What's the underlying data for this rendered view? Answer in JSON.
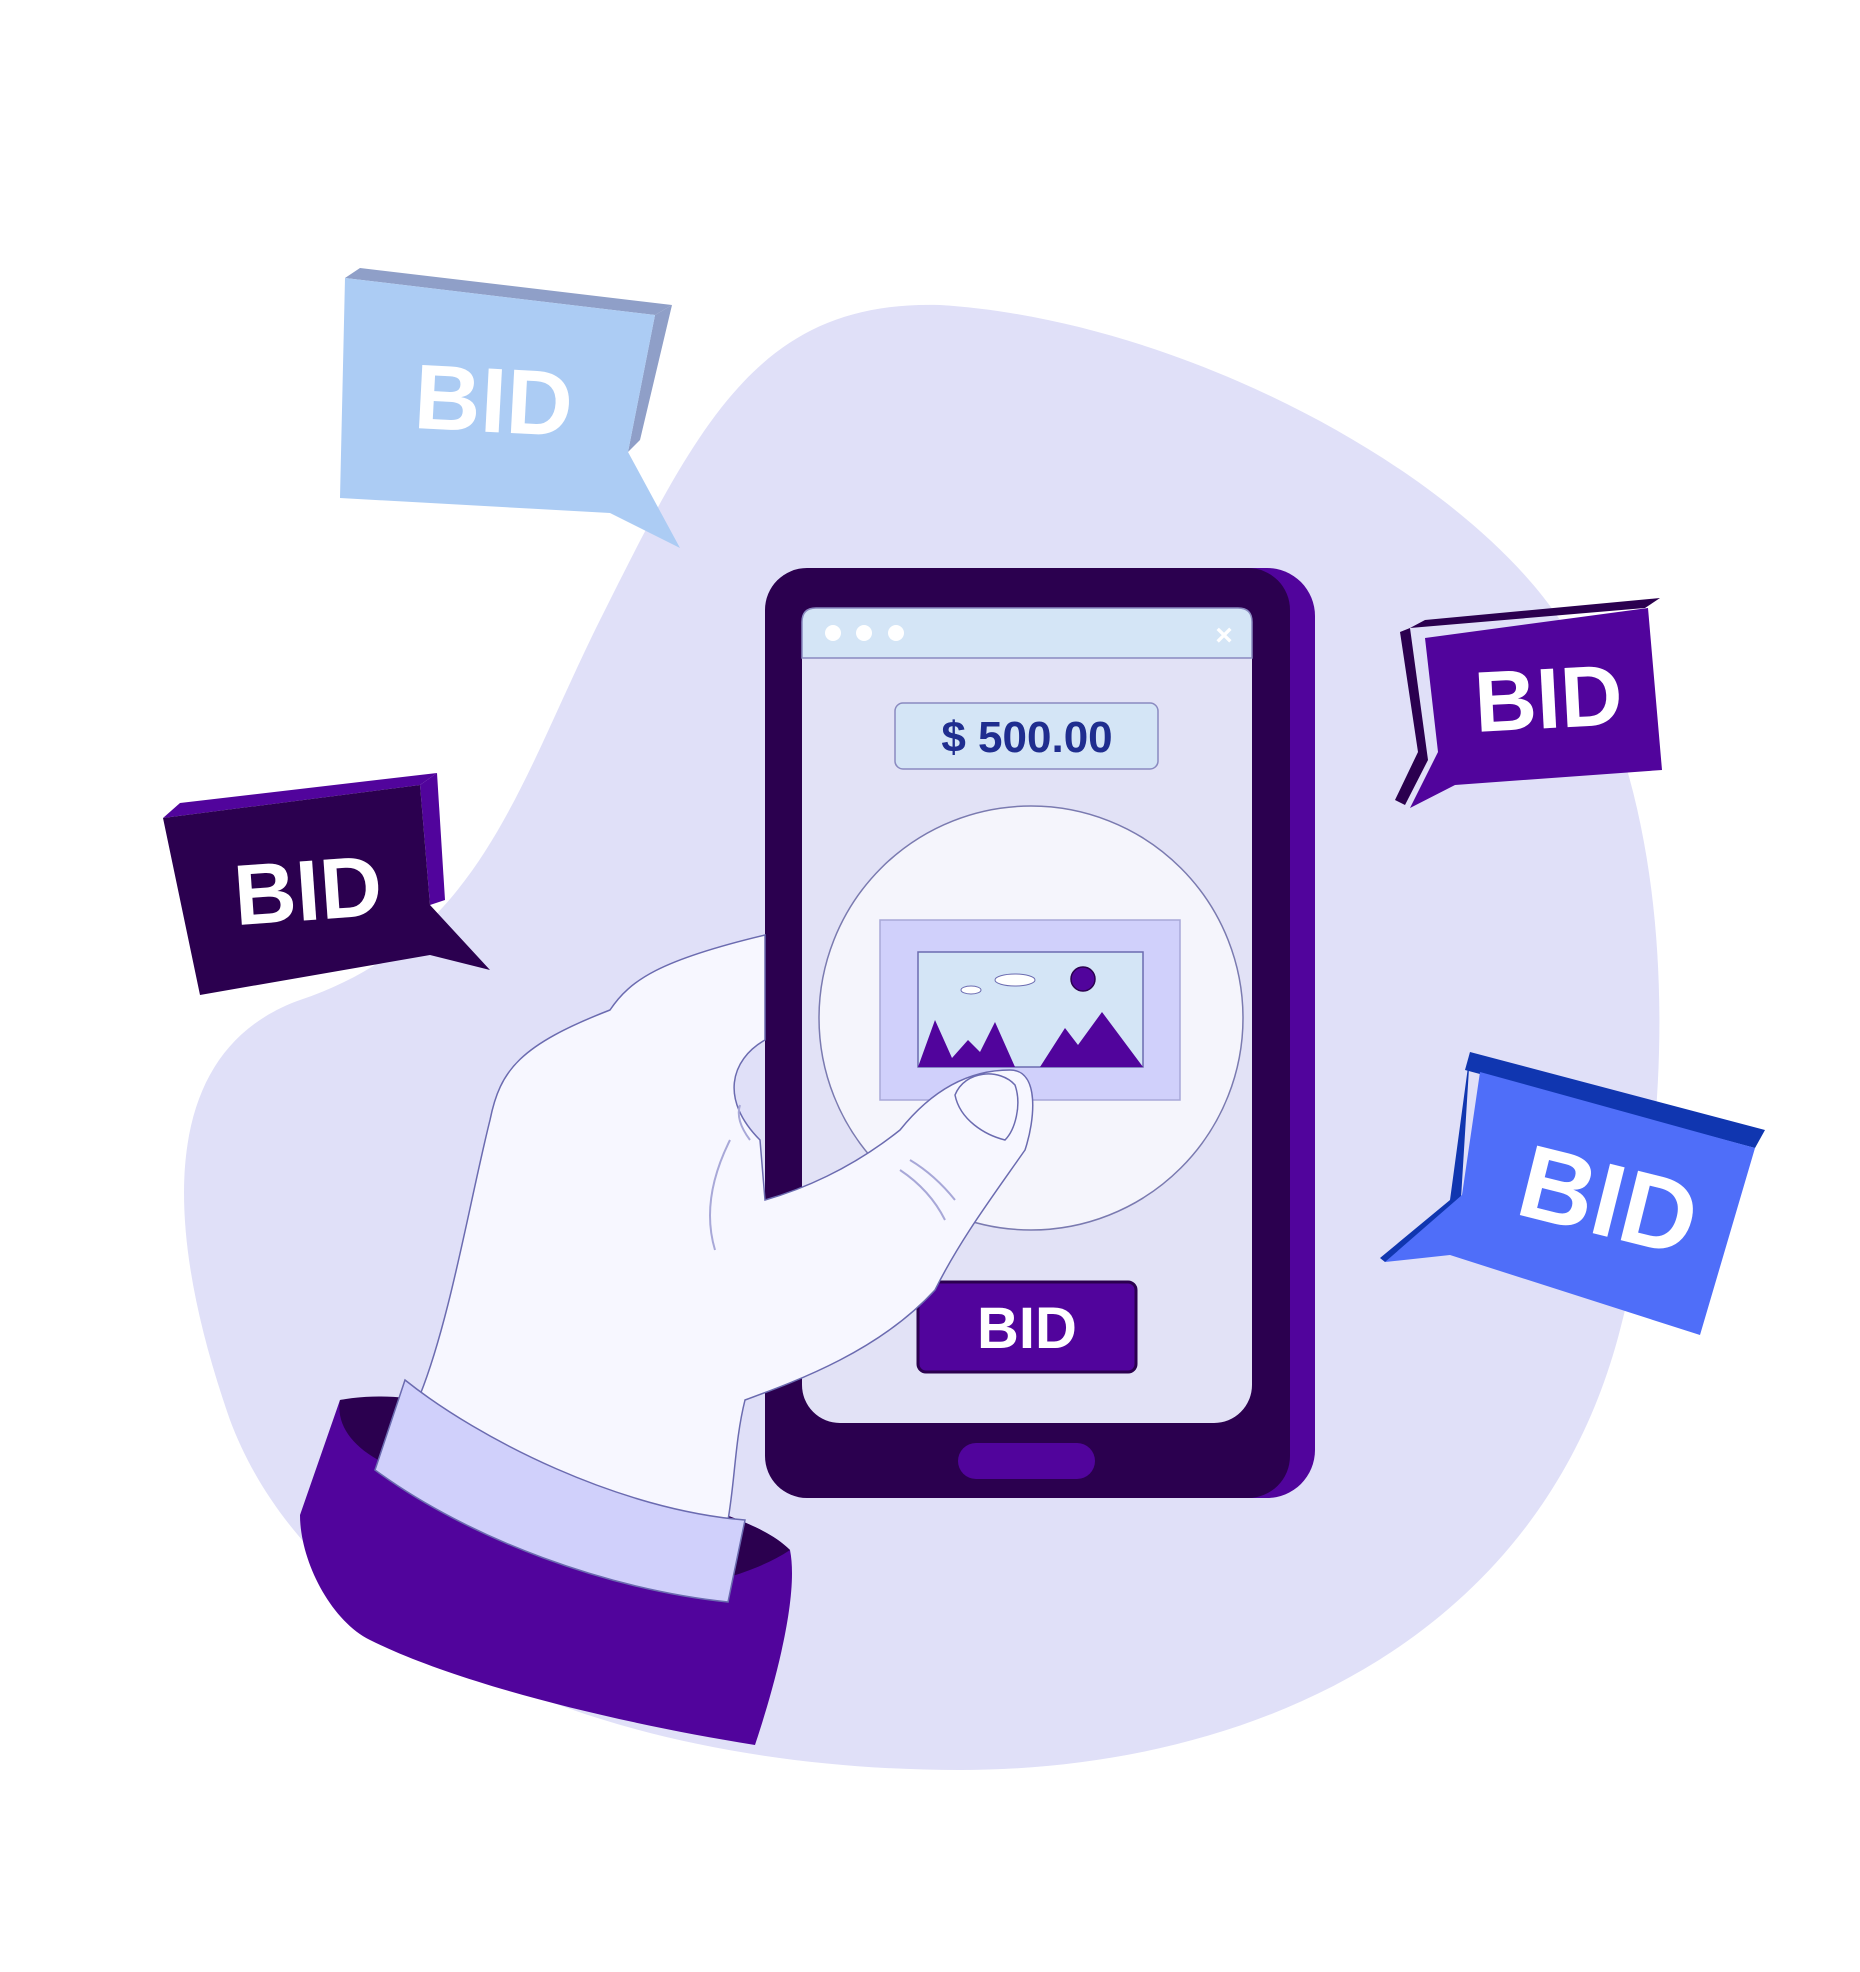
{
  "illustration": {
    "price": "$ 500.00",
    "bid_button_label": "BID",
    "bubbles": [
      {
        "label": "BID",
        "style": "light-blue"
      },
      {
        "label": "BID",
        "style": "dark-purple"
      },
      {
        "label": "BID",
        "style": "purple"
      },
      {
        "label": "BID",
        "style": "blue"
      }
    ],
    "window_dots": 3,
    "close_glyph": "×"
  },
  "colors": {
    "blob": "#e0e0f8",
    "phone_body": "#2b004f",
    "phone_edge": "#51049c",
    "screen": "#e2e2f6",
    "titlebar": "#d4e5f6",
    "price_text": "#1f2d8f",
    "bid_button": "#51049c",
    "hand": "#f7f7ff",
    "cuff": "#d0d0fb",
    "sleeve": "#51049c",
    "bubble_light_blue": "#acccf4",
    "bubble_dark_purple": "#2b004f",
    "bubble_purple": "#51049c",
    "bubble_blue": "#4f6ef9"
  }
}
